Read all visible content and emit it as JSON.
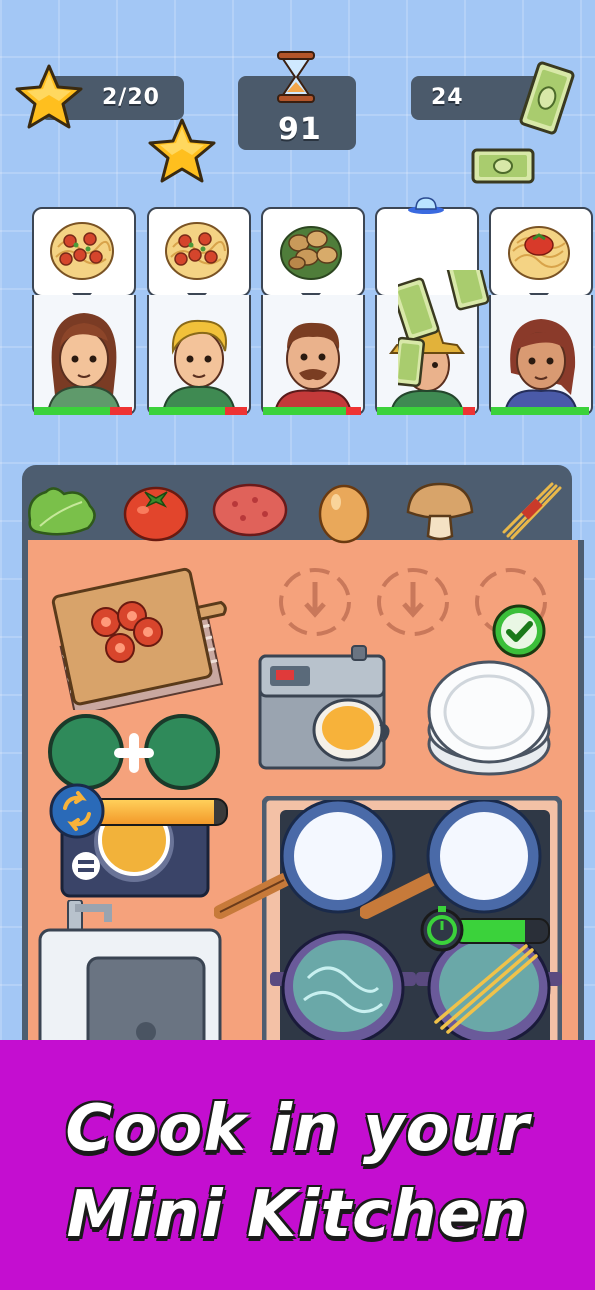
{
  "hud": {
    "stars": "2/20",
    "timer": "91",
    "money": "24"
  },
  "customers": [
    {
      "order": "spaghetti-meatballs",
      "patience": 0.78
    },
    {
      "order": "spaghetti-meatballs",
      "patience": 0.78
    },
    {
      "order": "mushrooms",
      "patience": 0.85
    },
    {
      "order": "none",
      "patience": 0.88
    },
    {
      "order": "spaghetti-tomato",
      "patience": 1.0
    }
  ],
  "ingredients": [
    "lettuce",
    "tomato",
    "meat-patty",
    "egg",
    "mushroom",
    "spaghetti"
  ],
  "promo": {
    "line1": "Cook in your",
    "line2": "Mini Kitchen"
  },
  "colors": {
    "background": "#a3c7f5",
    "counter": "#f5a27c",
    "panel": "#4d5d70",
    "promo": "#c40ed0",
    "patience_ok": "#3bd23b",
    "patience_low": "#e33333"
  }
}
